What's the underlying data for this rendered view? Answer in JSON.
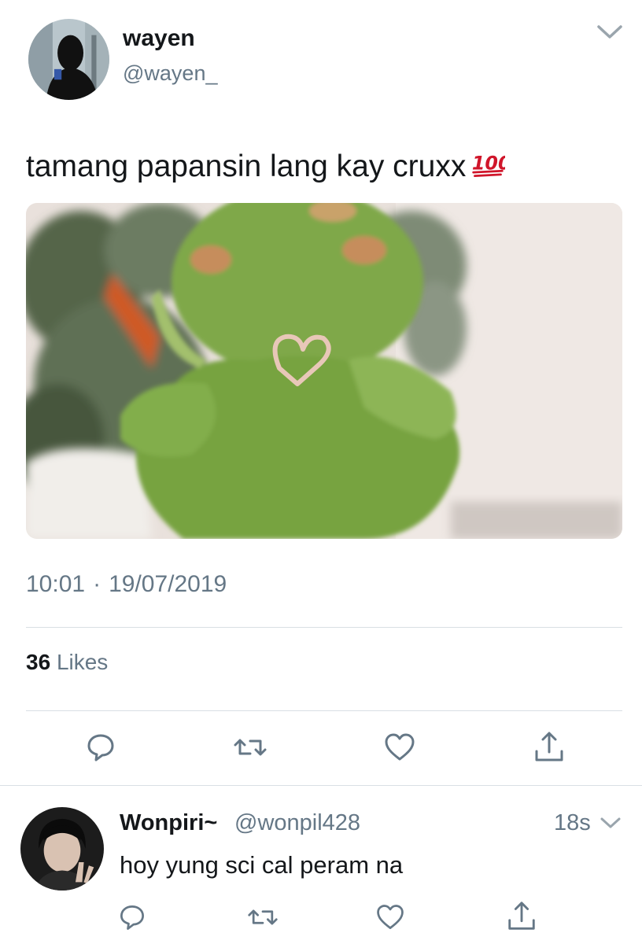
{
  "tweet": {
    "author_name": "wayen",
    "author_handle": "@wayen_",
    "text": "tamang papansin lang kay cruxx",
    "emoji": "hundred-points-icon",
    "time": "10:01",
    "date": "19/07/2019",
    "likes_count": "36",
    "likes_label": "Likes"
  },
  "reply": {
    "author_name": "Wonpiri~",
    "author_handle": "@wonpil428",
    "time": "18s",
    "text": "hoy yung sci cal peram na"
  },
  "icons": {
    "reply": "reply-icon",
    "retweet": "retweet-icon",
    "like": "heart-icon",
    "share": "share-icon",
    "more": "chevron-down-icon"
  },
  "colors": {
    "text": "#14171a",
    "secondary": "#657786",
    "divider": "#d9dfe4",
    "emoji_red": "#d0152a"
  }
}
